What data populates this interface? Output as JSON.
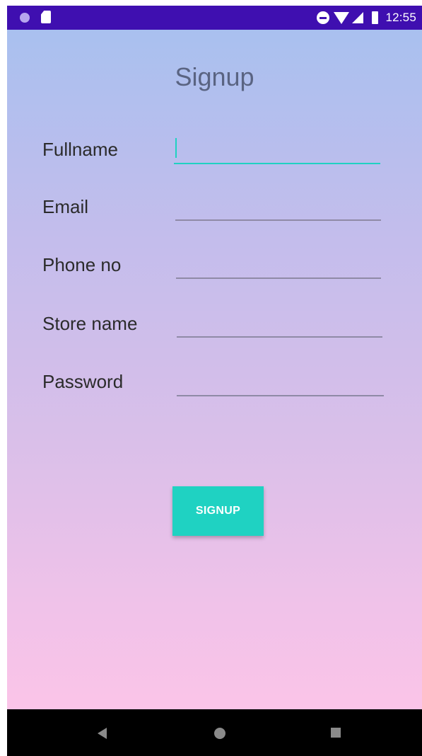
{
  "status_bar": {
    "time": "12:55",
    "icons": [
      "notification-dot-icon",
      "sd-card-icon",
      "do-not-disturb-icon",
      "wifi-icon",
      "signal-icon",
      "battery-icon"
    ]
  },
  "screen": {
    "title": "Signup"
  },
  "form": {
    "fields": [
      {
        "label": "Fullname",
        "value": "",
        "focused": true
      },
      {
        "label": "Email",
        "value": ""
      },
      {
        "label": "Phone no",
        "value": ""
      },
      {
        "label": "Store name",
        "value": ""
      },
      {
        "label": "Password",
        "value": ""
      }
    ],
    "submit_label": "SIGNUP"
  },
  "nav_bar": {
    "icons": [
      "back-icon",
      "home-icon",
      "recents-icon"
    ]
  },
  "colors": {
    "status_bar": "#3f0fb0",
    "accent": "#1fd2c2",
    "gradient_top": "#a9c0ef",
    "gradient_bottom": "#fbc4e8"
  }
}
